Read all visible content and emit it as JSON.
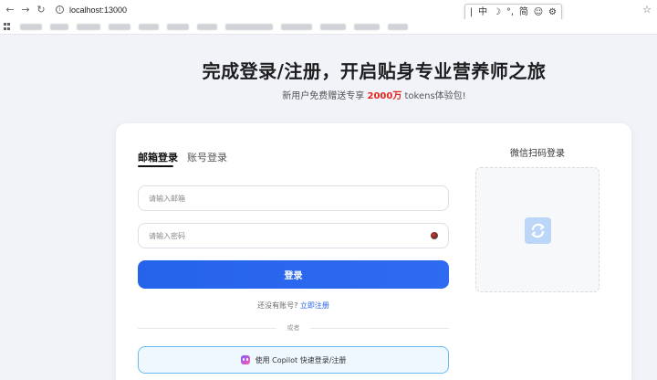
{
  "browser": {
    "url": "localhost:13000"
  },
  "ime": {
    "items": [
      "|",
      "中",
      "☽",
      "°,",
      "简",
      "☺",
      "⚙"
    ]
  },
  "hero": {
    "title": "完成登录/注册，开启贴身专业营养师之旅",
    "subtitle_prefix": "新用户免费赠送专享 ",
    "subtitle_highlight": "2000万",
    "subtitle_suffix": " tokens体验包!"
  },
  "login": {
    "tab_email": "邮箱登录",
    "tab_account": "账号登录",
    "email_placeholder": "请输入邮箱",
    "password_placeholder": "请输入密码",
    "login_button": "登录",
    "no_account": "还没有账号?",
    "register_link": "立即注册",
    "divider_text": "或者",
    "copilot_button": "使用 Copilot 快速登录/注册"
  },
  "wechat": {
    "title": "微信扫码登录"
  },
  "colors": {
    "primary": "#2563eb",
    "highlight": "#e5261f",
    "copilot_border": "#67bdf0"
  }
}
